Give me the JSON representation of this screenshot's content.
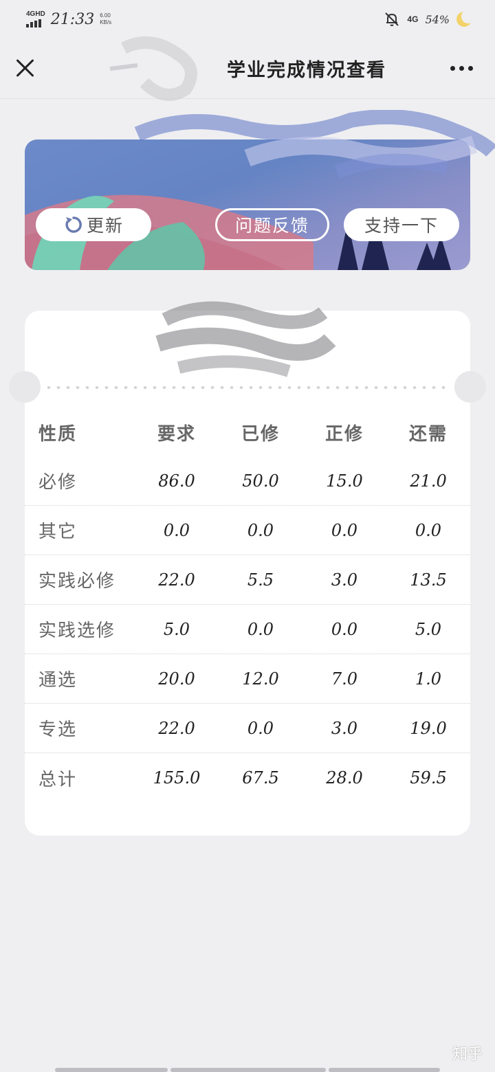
{
  "status_bar": {
    "signal": "4GHD",
    "time": "21:33",
    "net_speed_value": "6.00",
    "net_speed_unit": "KB/s",
    "network": "4G",
    "battery": "54%"
  },
  "nav": {
    "title": "学业完成情况查看"
  },
  "banner": {
    "refresh_label": "更新",
    "feedback_label": "问题反馈",
    "support_label": "支持一下"
  },
  "table": {
    "headers": [
      "性质",
      "要求",
      "已修",
      "正修",
      "还需"
    ],
    "rows": [
      {
        "label": "必修",
        "values": [
          "86.0",
          "50.0",
          "15.0",
          "21.0"
        ]
      },
      {
        "label": "其它",
        "values": [
          "0.0",
          "0.0",
          "0.0",
          "0.0"
        ]
      },
      {
        "label": "实践必修",
        "values": [
          "22.0",
          "5.5",
          "3.0",
          "13.5"
        ]
      },
      {
        "label": "实践选修",
        "values": [
          "5.0",
          "0.0",
          "0.0",
          "5.0"
        ]
      },
      {
        "label": "通选",
        "values": [
          "20.0",
          "12.0",
          "7.0",
          "1.0"
        ]
      },
      {
        "label": "专选",
        "values": [
          "22.0",
          "0.0",
          "3.0",
          "19.0"
        ]
      },
      {
        "label": "总计",
        "values": [
          "155.0",
          "67.5",
          "28.0",
          "59.5"
        ]
      }
    ]
  },
  "watermark": "知乎",
  "colors": {
    "background": "#efeff1",
    "banner": "#6c8ac9",
    "card": "#ffffff"
  }
}
